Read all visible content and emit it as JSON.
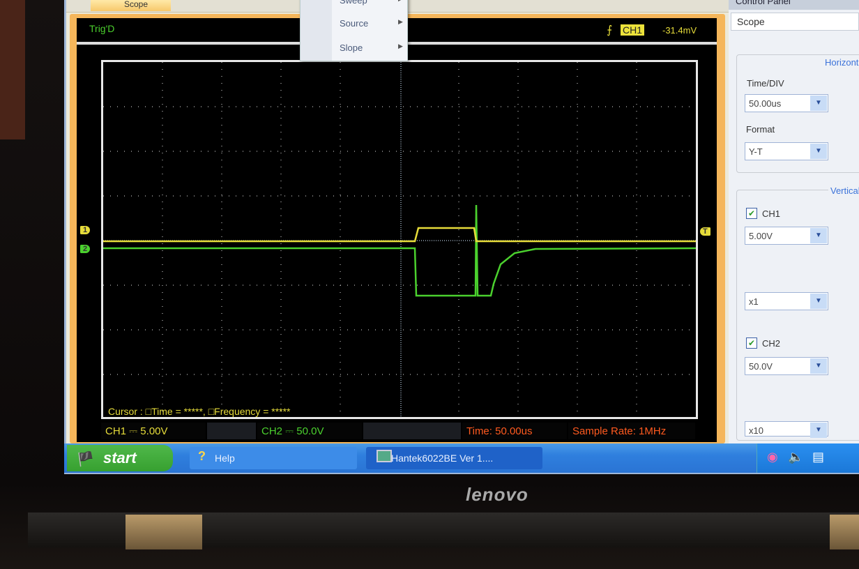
{
  "app": {
    "tab": "Scope"
  },
  "menu": {
    "items": [
      {
        "label": "Sweep"
      },
      {
        "label": "Source"
      },
      {
        "label": "Slope"
      }
    ]
  },
  "scope": {
    "trigger_status": "Trig'D",
    "trigger_channel": "CH1",
    "trigger_level": "-31.4mV",
    "markers": {
      "ch1": "1",
      "ch2": "2",
      "trigger": "T"
    },
    "colors": {
      "ch1": "#e6dc3a",
      "ch2": "#4bd12e",
      "time": "#ff5a1f"
    },
    "cursor_text": "Cursor : □Time = *****, □Frequency = *****",
    "status": {
      "ch1": "CH1 ⎓ 5.00V",
      "ch2": "CH2 ⎓ 50.0V",
      "time": "Time: 50.00us",
      "sample_rate": "Sample Rate: 1MHz"
    }
  },
  "panel": {
    "title": "Control Panel",
    "selected": "Scope",
    "horizontal": {
      "label": "Horizontal",
      "time_div_label": "Time/DIV",
      "time_div": "50.00us",
      "format_label": "Format",
      "format": "Y-T"
    },
    "vertical": {
      "label": "Vertical",
      "ch1_label": "CH1",
      "ch1_checked": true,
      "ch1_volts": "5.00V",
      "ch1_probe": "x1",
      "ch2_label": "CH2",
      "ch2_checked": true,
      "ch2_volts": "50.0V",
      "ch2_probe": "x10"
    }
  },
  "taskbar": {
    "start": "start",
    "items": [
      {
        "label": "Help"
      },
      {
        "label": "Hantek6022BE Ver 1...."
      }
    ]
  },
  "laptop": {
    "brand": "lenovo"
  }
}
